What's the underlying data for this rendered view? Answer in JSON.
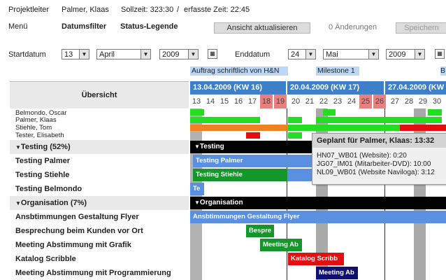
{
  "header": {
    "projektleiter_label": "Projektleiter",
    "projektleiter_value": "Palmer, Klaas",
    "sollzeit_label": "Sollzeit: 323:30",
    "separator": "/",
    "erfasste_label": "erfasste Zeit: 22:45",
    "menu_label": "Menü",
    "datumsfilter": "Datumsfilter",
    "status_legende": "Status-Legende",
    "refresh_button": "Ansicht aktualisieren",
    "changes": "0 Änderungen",
    "save_button": "Speichern"
  },
  "filter": {
    "start_label": "Startdatum",
    "start_day": "13",
    "start_month": "April",
    "start_year": "2009",
    "end_label": "Enddatum",
    "end_day": "24",
    "end_month": "Mai",
    "end_year": "2009"
  },
  "milestones": {
    "m1": "Auftrag schriftlich von H&N",
    "m2": "Milestone 1",
    "m3": "B"
  },
  "overview_label": "Übersicht",
  "weeks": [
    "13.04.2009 (KW 16)",
    "20.04.2009 (KW 17)",
    "27.04.2009 (KW"
  ],
  "days": [
    "13",
    "14",
    "15",
    "16",
    "17",
    "18",
    "19",
    "20",
    "21",
    "22",
    "23",
    "24",
    "25",
    "26",
    "27",
    "28",
    "29",
    "30",
    "1",
    "2"
  ],
  "people": [
    "Belmondo, Oscar",
    "Palmer, Klaas",
    "Stiehle, Tom",
    "Tester, Elisabeth"
  ],
  "groups": {
    "testing": "Testing (52%)",
    "testing_bar": "Testing",
    "organisation": "Organisation (7%)",
    "organisation_bar": "Organisation"
  },
  "tasks": {
    "testing_palmer": "Testing Palmer",
    "testing_stiehle": "Testing Stiehle",
    "testing_belmondo": "Testing Belmondo",
    "flyer": "Ansbtimmungen Gestaltung Flyer",
    "kunde": "Besprechung beim Kunden vor Ort",
    "grafik": "Meeting Abstimmung mit Grafik",
    "katalog": "Katalog Scribble",
    "prog": "Meeting Abstimmung mit Programmierung"
  },
  "bars": {
    "testing_palmer": "Testing Palmer",
    "testing_stiehle": "Testing Stiehle",
    "testing_belmondo": "Te",
    "flyer": "Ansbtimmungen Gestaltung Flyer",
    "kunde": "Bespre",
    "grafik": "Meeting Ab",
    "katalog": "Katalog Scribb",
    "prog": "Meeting Ab"
  },
  "tooltip": {
    "title": "Geplant für Palmer, Klaas: 13:32",
    "lines": [
      "HN07_WB01 (Website): 0:20",
      "JG07_IM01 (Mitarbeiter-DVD): 10:00",
      "NL09_WB01 (Website Naviloga): 3:12"
    ]
  },
  "colors": {
    "week_header": "#3d7fc8",
    "milestone": "#bcd8f5",
    "weekend_header": "#e88080",
    "bar_blue": "#5b8fe0",
    "bar_green": "#14962a",
    "bar_red": "#e01010",
    "bar_navy": "#101070",
    "load_green": "#22dd22",
    "load_orange": "#f08020",
    "load_red": "#e01010"
  }
}
